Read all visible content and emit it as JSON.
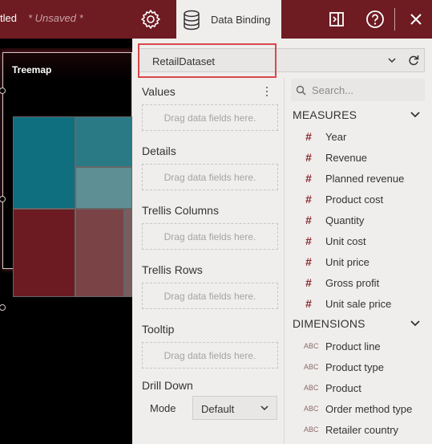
{
  "header": {
    "title_fragment": "tled",
    "unsaved": "* Unsaved *",
    "active_tab": "Data Binding"
  },
  "canvas": {
    "widget_title": "Treemap"
  },
  "dataset": {
    "selected": "RetailDataset"
  },
  "binding": {
    "sections": [
      {
        "label": "Values",
        "placeholder": "Drag data fields here."
      },
      {
        "label": "Details",
        "placeholder": "Drag data fields here."
      },
      {
        "label": "Trellis Columns",
        "placeholder": "Drag data fields here."
      },
      {
        "label": "Trellis Rows",
        "placeholder": "Drag data fields here."
      },
      {
        "label": "Tooltip",
        "placeholder": "Drag data fields here."
      }
    ],
    "drill_down": {
      "label": "Drill Down",
      "mode_label": "Mode",
      "mode_value": "Default"
    }
  },
  "fields": {
    "search_placeholder": "Search...",
    "measures_label": "MEASURES",
    "measures": [
      "Year",
      "Revenue",
      "Planned revenue",
      "Product cost",
      "Quantity",
      "Unit cost",
      "Unit price",
      "Gross profit",
      "Unit sale price"
    ],
    "measure_symbol": "#",
    "dimensions_label": "DIMENSIONS",
    "dimension_symbol": "ABC",
    "dimensions": [
      "Product line",
      "Product type",
      "Product",
      "Order method type",
      "Retailer country"
    ]
  },
  "colors": {
    "header": "#6e1b22",
    "panel": "#f0eeec",
    "highlight": "#d8484b",
    "treemap_teal": "#0f6f7e",
    "treemap_maroon": "#6c1b22"
  }
}
